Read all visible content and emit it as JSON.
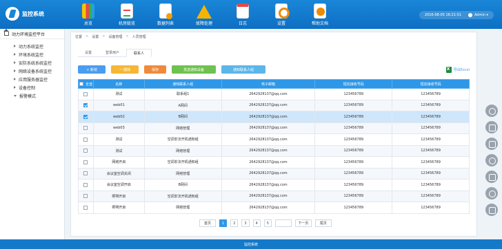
{
  "app": {
    "title": "监控系统"
  },
  "nav": [
    {
      "label": "总览",
      "icon": "dashboard-icon"
    },
    {
      "label": "机房総览",
      "icon": "machine-room-icon"
    },
    {
      "label": "数据列表",
      "icon": "data-list-icon"
    },
    {
      "label": "故障处理",
      "icon": "warning-icon"
    },
    {
      "label": "日志",
      "icon": "calendar-log-icon"
    },
    {
      "label": "设置",
      "icon": "settings-icon"
    },
    {
      "label": "帮助文档",
      "icon": "help-icon"
    }
  ],
  "header": {
    "datetime": "2016-08-05 16:21:51",
    "user": "Admin ▾"
  },
  "sidebar": {
    "title": "动力环境监控平台",
    "items": [
      {
        "label": "动力系统监控"
      },
      {
        "label": "环境系统监控"
      },
      {
        "label": "安防系统系统监控"
      },
      {
        "label": "网络设备系统监控"
      },
      {
        "label": "应用服务器监控"
      },
      {
        "label": "设备控制"
      },
      {
        "label": "报警模式"
      }
    ]
  },
  "breadcrumb": {
    "root": "位置",
    "sep": ">",
    "a": "设置",
    "b": "设备管理",
    "c": "人员管理"
  },
  "tabs": [
    {
      "label": "设置"
    },
    {
      "label": "登录用户"
    },
    {
      "label": "联系人"
    }
  ],
  "toolbar": {
    "add": "+ 新增",
    "delete": "一 删除",
    "save": "保存",
    "notify": "发送通知设备",
    "query": "通知联系人组"
  },
  "export": {
    "label": "导出Excel"
  },
  "table": {
    "headers": {
      "select": "全选",
      "name": "名称",
      "group": "通知联系人组",
      "email": "电子邮箱",
      "sms": "短信接收号码",
      "phone": "短信接收号码"
    },
    "rows": [
      {
        "name": "测试",
        "group": "联系组1",
        "email": "2642928137@qq.com",
        "sms": "123456789",
        "phone": "123456789",
        "checked": false
      },
      {
        "name": "web01",
        "group": "A网间",
        "email": "2642928137@qq.com",
        "sms": "123456789",
        "phone": "123456789",
        "checked": true
      },
      {
        "name": "web02",
        "group": "B网间",
        "email": "2642928137@qq.com",
        "sms": "123456789",
        "phone": "123456789",
        "checked": true
      },
      {
        "name": "web03",
        "group": "网络管理",
        "email": "2642928137@qq.com",
        "sms": "123456789",
        "phone": "123456789",
        "checked": false
      },
      {
        "name": "测试",
        "group": "空调非法开机通知组",
        "email": "2642928137@qq.com",
        "sms": "123456789",
        "phone": "123456789",
        "checked": false
      },
      {
        "name": "测试",
        "group": "网络管理",
        "email": "2642928137@qq.com",
        "sms": "123456789",
        "phone": "123456789",
        "checked": false
      },
      {
        "name": "网络开启",
        "group": "空调非法开机通知组",
        "email": "2642928137@qq.com",
        "sms": "123456789",
        "phone": "123456789",
        "checked": false
      },
      {
        "name": "会议室空调关闭",
        "group": "网络管理",
        "email": "2642928137@qq.com",
        "sms": "123456789",
        "phone": "123456789",
        "checked": false
      },
      {
        "name": "会议室空调开启",
        "group": "B网间",
        "email": "2642928137@qq.com",
        "sms": "123456789",
        "phone": "123456789",
        "checked": false
      },
      {
        "name": "照明开启",
        "group": "空调非法开机通知组",
        "email": "2642928137@qq.com",
        "sms": "123456789",
        "phone": "123456789",
        "checked": false
      },
      {
        "name": "照明开启",
        "group": "网络管理",
        "email": "2642928137@qq.com",
        "sms": "123456789",
        "phone": "123456789",
        "checked": false
      }
    ]
  },
  "pager": {
    "first": "首页",
    "pages": [
      "1",
      "2",
      "3",
      "4",
      "5"
    ],
    "current": "1",
    "next": "下一页",
    "last": "尾页"
  },
  "footer": {
    "text": "监控系统"
  }
}
